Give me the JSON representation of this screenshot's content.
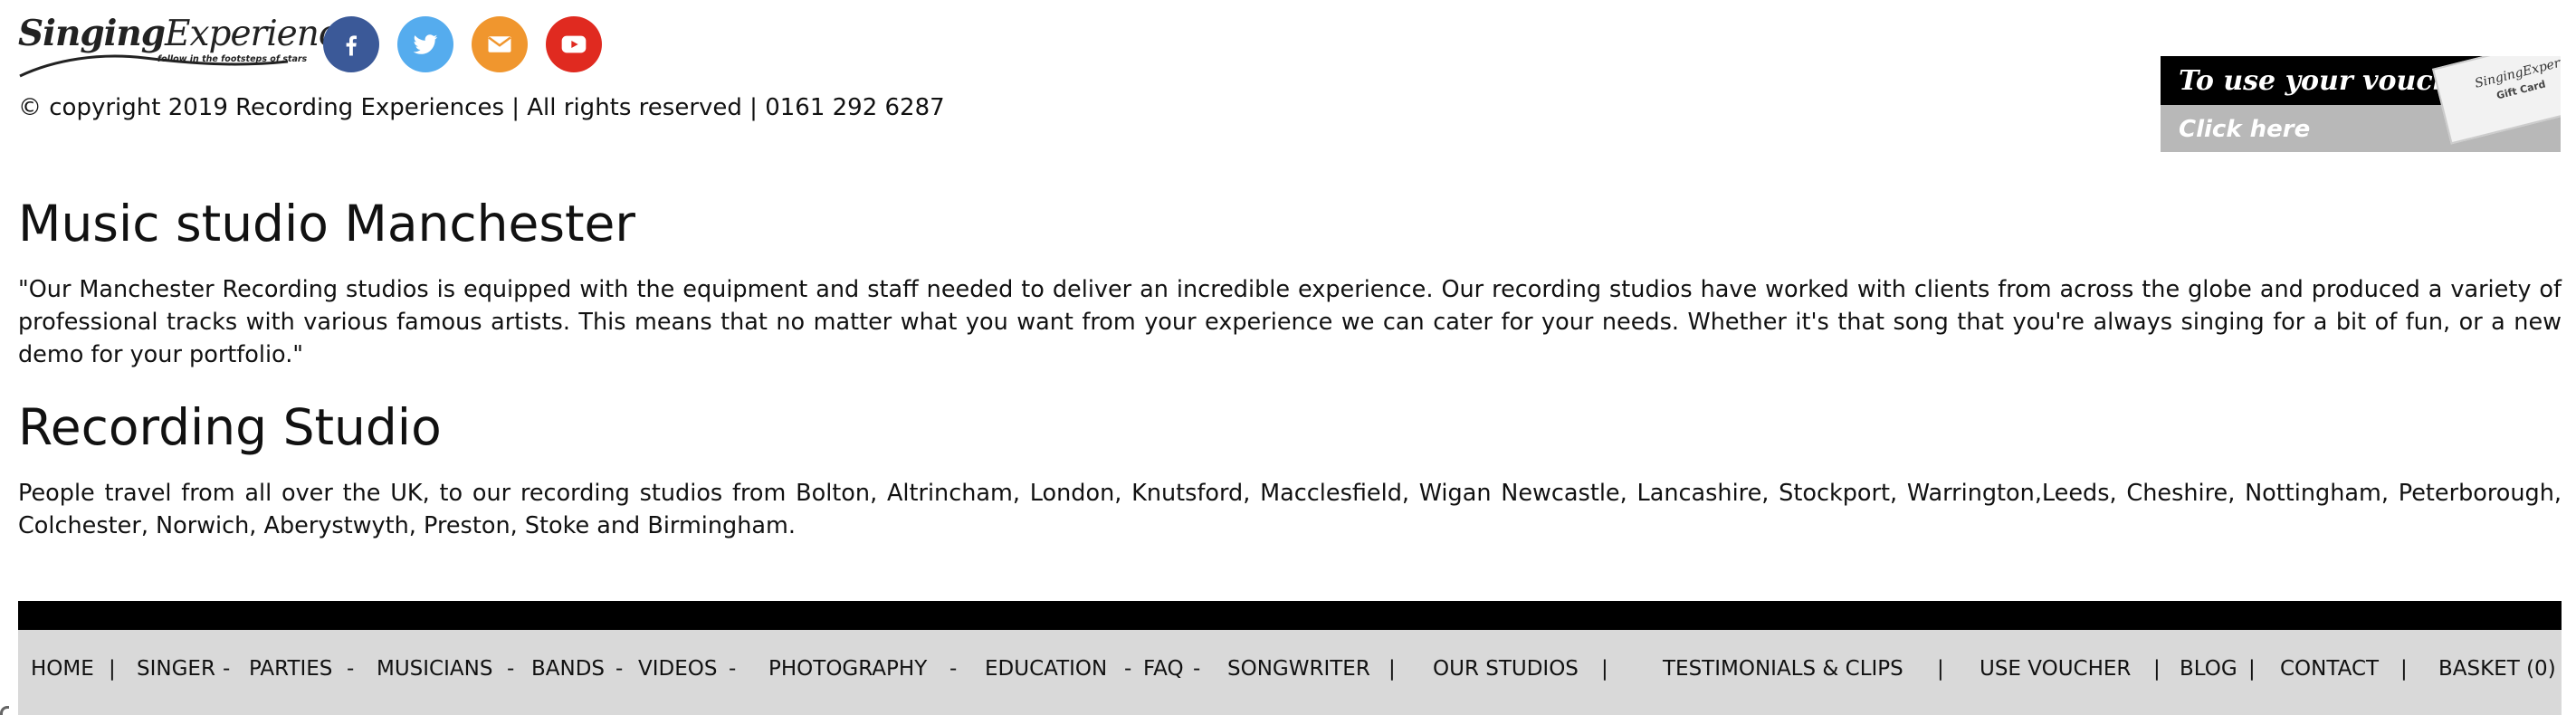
{
  "logo": {
    "word_bold": "Singing",
    "word_light": "Experience",
    "tagline": "follow in the footsteps of stars"
  },
  "social": [
    {
      "name": "facebook-icon",
      "color": "#3b5998"
    },
    {
      "name": "twitter-icon",
      "color": "#55acee"
    },
    {
      "name": "email-icon",
      "color": "#f0962e"
    },
    {
      "name": "youtube-icon",
      "color": "#e02a20"
    }
  ],
  "copyright": "© copyright 2019 Recording Experiences | All rights reserved | 0161 292 6287",
  "voucher": {
    "line1": "To use your voucher",
    "line2": "Click here",
    "card_brand": "SingingExperience",
    "card_label": "Gift Card"
  },
  "sections": [
    {
      "heading": "Music studio Manchester",
      "text": "\"Our Manchester Recording studios is equipped with the equipment and staff needed to deliver an incredible experience. Our recording studios have worked with clients from across the globe and produced a variety of professional tracks with various famous artists. This means that no matter what you want from your experience we can cater for your needs. Whether it's that song that you're always singing for a bit of fun, or a new demo for your portfolio.\""
    },
    {
      "heading": "Recording Studio",
      "text": "People travel from all over the UK, to our recording studios from Bolton, Altrincham, London, Knutsford, Macclesfield, Wigan Newcastle, Lancashire, Stockport, Warrington,Leeds, Cheshire, Nottingham, Peterborough, Colchester, Norwich, Aberystwyth, Preston, Stoke and Birmingham."
    }
  ],
  "nav": {
    "items": [
      "HOME",
      "SINGER",
      "PARTIES",
      "MUSICIANS",
      "BANDS",
      "VIDEOS",
      "PHOTOGRAPHY",
      "EDUCATION",
      "FAQ",
      "SONGWRITER",
      "OUR STUDIOS",
      "TESTIMONIALS & CLIPS",
      "USE VOUCHER",
      "BLOG",
      "CONTACT",
      "BASKET (0)"
    ],
    "separators": [
      "|",
      "-",
      "-",
      "-",
      "-",
      "-",
      "-",
      "-",
      "-",
      "|",
      "|",
      "|",
      "|",
      "|",
      "|"
    ]
  }
}
